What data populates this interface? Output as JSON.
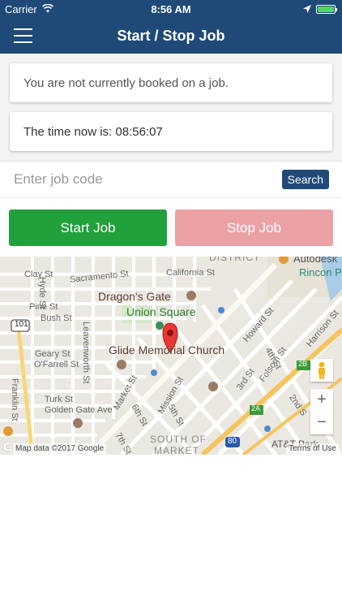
{
  "status_bar": {
    "carrier": "Carrier",
    "time": "8:56 AM"
  },
  "nav": {
    "title": "Start / Stop Job",
    "menu_icon": "hamburger-menu-icon"
  },
  "booking": {
    "status_text": "You are not currently booked on a job.",
    "time_label": "The time now is:",
    "time_value": "08:56:07",
    "time_text": "The time now is: 08:56:07"
  },
  "job_code": {
    "placeholder": "Enter job code",
    "value": "",
    "search_label": "Search"
  },
  "actions": {
    "start_label": "Start Job",
    "stop_label": "Stop Job",
    "start_color": "#21a03c",
    "stop_color": "#eba1a5"
  },
  "map": {
    "labels": {
      "dragons_gate": "Dragon's Gate",
      "union_square": "Union Square",
      "glide": "Glide Memorial Church",
      "autodesk": "Autodesk",
      "rincon": "Rincon P",
      "att_park": "AT&T Park",
      "south_of_market_1": "SOUTH OF",
      "south_of_market_2": "MARKET",
      "district": "DISTRICT",
      "clay": "Clay St",
      "sacramento": "Sacramento St",
      "california": "California St",
      "pine": "Pine St",
      "bush": "Bush St",
      "geary": "Geary St",
      "ofarrell": "O'Farrell St",
      "turk": "Turk St",
      "golden_gate": "Golden Gate Ave",
      "hyde": "Hyde St",
      "leavenworth": "Leavenworth St",
      "franklin": "Franklin St",
      "market": "Market St",
      "mission": "Mission St",
      "sixth": "6th St",
      "fifth": "5th St",
      "seventh": "7th St",
      "howard": "Howard St",
      "folsom": "Folsom St",
      "third": "3rd St",
      "second": "2nd S",
      "harrison": "Harrison St",
      "fourth": "4th St",
      "hwy101": "101",
      "hwy80": "80",
      "exit2a": "2A",
      "exit2b": "2B"
    },
    "map_data": "Map data ©2017 Google",
    "terms": "Terms of Use",
    "google": "Google",
    "zoom_in": "+",
    "zoom_out": "−"
  }
}
